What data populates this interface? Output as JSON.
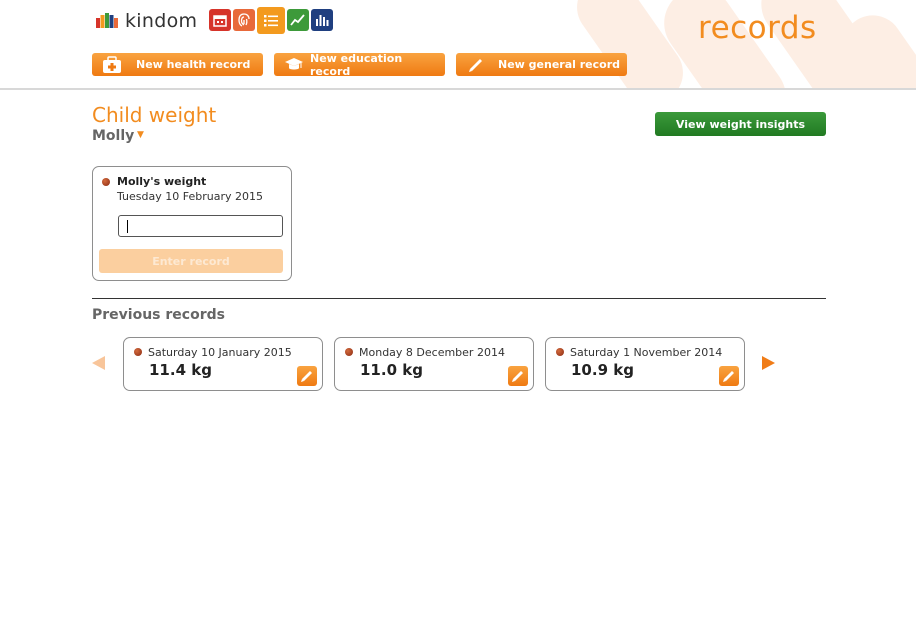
{
  "brand": {
    "name": "kindom"
  },
  "app_icons": [
    {
      "icon": "calendar-icon",
      "color": "#d6342a"
    },
    {
      "icon": "fingerprint-icon",
      "color": "#e8693a"
    },
    {
      "icon": "records-list-icon",
      "color": "#f39a1e"
    },
    {
      "icon": "growth-chart-icon",
      "color": "#3d9a3a"
    },
    {
      "icon": "bar-chart-icon",
      "color": "#1f3f80"
    }
  ],
  "section_title": "records",
  "toolbar": {
    "new_health": "New health record",
    "new_education": "New education record",
    "new_general": "New general record"
  },
  "page": {
    "title": "Child weight",
    "child": "Molly",
    "insights_button": "View weight insights"
  },
  "entry": {
    "label": "Molly's weight",
    "date": "Tuesday 10 February 2015",
    "input_value": "",
    "submit_label": "Enter record"
  },
  "previous": {
    "heading": "Previous records",
    "records": [
      {
        "date": "Saturday 10 January 2015",
        "value": "11.4 kg"
      },
      {
        "date": "Monday 8 December 2014",
        "value": "11.0 kg"
      },
      {
        "date": "Saturday 1 November 2014",
        "value": "10.9 kg"
      }
    ]
  },
  "colors": {
    "accent": "#f28c1f",
    "insights": "#2a8a2b",
    "text_muted": "#666666"
  }
}
